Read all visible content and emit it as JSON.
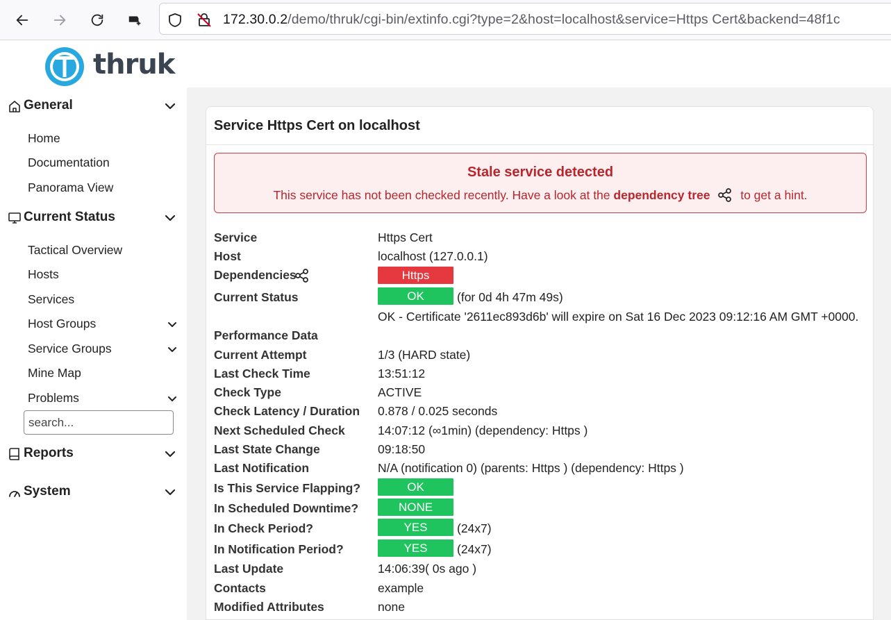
{
  "browser": {
    "url_host": "172.30.0.2",
    "url_path": "/demo/thruk/cgi-bin/extinfo.cgi?type=2&host=localhost&service=Https Cert&backend=48f1c"
  },
  "sidebar": {
    "logo_text": "thruk",
    "search_placeholder": "search...",
    "sections": {
      "general": {
        "label": "General",
        "items": [
          "Home",
          "Documentation",
          "Panorama View"
        ]
      },
      "current_status": {
        "label": "Current Status",
        "items": [
          "Tactical Overview",
          "Hosts",
          "Services",
          "Host Groups",
          "Service Groups",
          "Mine Map",
          "Problems"
        ]
      },
      "reports": {
        "label": "Reports"
      },
      "system": {
        "label": "System"
      }
    }
  },
  "panel": {
    "title": "Service Https Cert on localhost",
    "alert": {
      "title": "Stale service detected",
      "msg_before": "This service has not been checked recently. Have a look at the",
      "msg_link": "dependency tree",
      "msg_after": "to get a hint."
    },
    "rows": {
      "service": {
        "label": "Service",
        "value": "Https Cert"
      },
      "host": {
        "label": "Host",
        "value": "localhost (127.0.0.1)"
      },
      "dependencies": {
        "label": "Dependencies",
        "badge": "Https"
      },
      "current_status": {
        "label": "Current Status",
        "badge": "OK",
        "extra": "(for 0d 4h 47m 49s)"
      },
      "status_info": {
        "value": "OK - Certificate '2611ec893d6b' will expire on Sat 16 Dec 2023 09:12:16 AM GMT +0000."
      },
      "performance_data": {
        "label": "Performance Data"
      },
      "current_attempt": {
        "label": "Current Attempt",
        "value": "1/3 (HARD state)"
      },
      "last_check_time": {
        "label": "Last Check Time",
        "value": "13:51:12"
      },
      "check_type": {
        "label": "Check Type",
        "value": "ACTIVE"
      },
      "latency": {
        "label": "Check Latency / Duration",
        "value": "0.878 / 0.025 seconds"
      },
      "next_check": {
        "label": "Next Scheduled Check",
        "value": "14:07:12 (∞1min) (dependency: Https )"
      },
      "last_state_change": {
        "label": "Last State Change",
        "value": "09:18:50"
      },
      "last_notification": {
        "label": "Last Notification",
        "value": "N/A (notification 0) (parents: Https ) (dependency: Https )"
      },
      "flapping": {
        "label": "Is This Service Flapping?",
        "badge": "OK"
      },
      "downtime": {
        "label": "In Scheduled Downtime?",
        "badge": "NONE"
      },
      "check_period": {
        "label": "In Check Period?",
        "badge": "YES",
        "extra": "(24x7)"
      },
      "notification_period": {
        "label": "In Notification Period?",
        "badge": "YES",
        "extra": "(24x7)"
      },
      "last_update": {
        "label": "Last Update",
        "value": "14:06:39( 0s ago )"
      },
      "contacts": {
        "label": "Contacts",
        "value": "example"
      },
      "modified_attributes": {
        "label": "Modified Attributes",
        "value": "none"
      }
    }
  },
  "colors": {
    "ok_green": "#1fc45e",
    "critical_red": "#e6393f",
    "alert_text": "#b8262c"
  }
}
